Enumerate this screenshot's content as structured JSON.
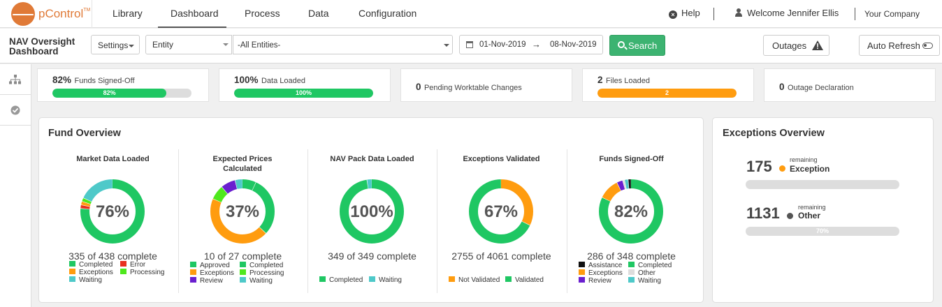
{
  "app": {
    "brand": "pControl",
    "trademark": "TM"
  },
  "nav": {
    "items": [
      "Library",
      "Dashboard",
      "Process",
      "Data",
      "Configuration"
    ],
    "active": "Dashboard"
  },
  "topright": {
    "help": "Help",
    "welcome": "Welcome Jennifer Ellis",
    "company": "Your Company"
  },
  "filters": {
    "page_title_1": "NAV Oversight",
    "page_title_2": "Dashboard",
    "settings": "Settings",
    "entity": "Entity",
    "entities": "-All Entities-",
    "date_from": "01-Nov-2019",
    "date_to": "08-Nov-2019",
    "search": "Search",
    "outages": "Outages",
    "auto_refresh": "Auto Refresh"
  },
  "kpis": [
    {
      "value": "82%",
      "label": "Funds Signed-Off",
      "bar_label": "82%",
      "bar_fraction": 0.82,
      "color": "#1fc763"
    },
    {
      "value": "100%",
      "label": "Data Loaded",
      "bar_label": "100%",
      "bar_fraction": 1.0,
      "color": "#1fc763"
    },
    {
      "value": "0",
      "label": "Pending Worktable Changes"
    },
    {
      "value": "2",
      "label": "Files Loaded",
      "bar_label": "2",
      "bar_fraction": 1.0,
      "color": "#ff9c0f"
    },
    {
      "value": "0",
      "label": "Outage Declaration"
    }
  ],
  "fund_overview": {
    "title": "Fund Overview",
    "charts": [
      {
        "title": "Market Data Loaded",
        "pct": "76%",
        "complete": "335 of 438 complete",
        "segments": [
          {
            "name": "Completed",
            "fraction": 0.765,
            "color": "#1fc763"
          },
          {
            "name": "Error",
            "fraction": 0.018,
            "color": "#e8301f"
          },
          {
            "name": "Exceptions",
            "fraction": 0.018,
            "color": "#ff9c0f"
          },
          {
            "name": "Processing",
            "fraction": 0.018,
            "color": "#4fe81d"
          },
          {
            "name": "Waiting",
            "fraction": 0.181,
            "color": "#4ec9c9"
          }
        ],
        "legend": [
          {
            "label": "Completed",
            "color": "#1fc763"
          },
          {
            "label": "Error",
            "color": "#e8301f"
          },
          {
            "label": "Exceptions",
            "color": "#ff9c0f"
          },
          {
            "label": "Processing",
            "color": "#4fe81d"
          },
          {
            "label": "Waiting",
            "color": "#4ec9c9"
          }
        ]
      },
      {
        "title": "Expected Prices Calculated",
        "pct": "37%",
        "complete": "10 of 27 complete",
        "segments": [
          {
            "name": "Completed",
            "fraction": 0.07,
            "color": "#1fc763"
          },
          {
            "name": "Approved",
            "fraction": 0.3,
            "color": "#1fc763"
          },
          {
            "name": "Exceptions",
            "fraction": 0.444,
            "color": "#ff9c0f"
          },
          {
            "name": "Processing",
            "fraction": 0.074,
            "color": "#4fe81d"
          },
          {
            "name": "Review",
            "fraction": 0.074,
            "color": "#6a1fcf"
          },
          {
            "name": "Waiting",
            "fraction": 0.038,
            "color": "#4ec9c9"
          }
        ],
        "legend": [
          {
            "label": "Approved",
            "color": "#1fc763"
          },
          {
            "label": "Completed",
            "color": "#1fc763"
          },
          {
            "label": "Exceptions",
            "color": "#ff9c0f"
          },
          {
            "label": "Processing",
            "color": "#4fe81d"
          },
          {
            "label": "Review",
            "color": "#6a1fcf"
          },
          {
            "label": "Waiting",
            "color": "#4ec9c9"
          }
        ]
      },
      {
        "title": "NAV Pack Data Loaded",
        "pct": "100%",
        "complete": "349 of 349 complete",
        "segments": [
          {
            "name": "Completed",
            "fraction": 0.975,
            "color": "#1fc763"
          },
          {
            "name": "Waiting",
            "fraction": 0.025,
            "color": "#4ec9c9"
          }
        ],
        "legend": [
          {
            "label": "Completed",
            "color": "#1fc763"
          },
          {
            "label": "Waiting",
            "color": "#4ec9c9"
          }
        ]
      },
      {
        "title": "Exceptions Validated",
        "pct": "67%",
        "complete": "2755 of 4061 complete",
        "segments": [
          {
            "name": "Not Validated",
            "fraction": 0.322,
            "color": "#ff9c0f"
          },
          {
            "name": "Validated",
            "fraction": 0.678,
            "color": "#1fc763"
          }
        ],
        "legend": [
          {
            "label": "Not Validated",
            "color": "#ff9c0f"
          },
          {
            "label": "Validated",
            "color": "#1fc763"
          }
        ]
      },
      {
        "title": "Funds Signed-Off",
        "pct": "82%",
        "complete": "286 of 348 complete",
        "segments": [
          {
            "name": "Completed",
            "fraction": 0.822,
            "color": "#1fc763"
          },
          {
            "name": "Exceptions",
            "fraction": 0.105,
            "color": "#ff9c0f"
          },
          {
            "name": "Review",
            "fraction": 0.03,
            "color": "#6a1fcf"
          },
          {
            "name": "Other",
            "fraction": 0.01,
            "color": "#dddddd"
          },
          {
            "name": "Waiting",
            "fraction": 0.018,
            "color": "#4ec9c9"
          },
          {
            "name": "Assistance",
            "fraction": 0.015,
            "color": "#111111"
          }
        ],
        "legend": [
          {
            "label": "Assistance",
            "color": "#111111"
          },
          {
            "label": "Completed",
            "color": "#1fc763"
          },
          {
            "label": "Exceptions",
            "color": "#ff9c0f"
          },
          {
            "label": "Other",
            "color": "#dddddd"
          },
          {
            "label": "Review",
            "color": "#6a1fcf"
          },
          {
            "label": "Waiting",
            "color": "#4ec9c9"
          }
        ]
      }
    ]
  },
  "exceptions_overview": {
    "title": "Exceptions Overview",
    "items": [
      {
        "count": "175",
        "remaining": "remaining",
        "label": "Exception",
        "dot_color": "#ff9c0f",
        "bar_label": "",
        "bar_fraction": 0
      },
      {
        "count": "1131",
        "remaining": "remaining",
        "label": "Other",
        "dot_color": "#555555",
        "bar_label": "70%",
        "bar_fraction": 0
      }
    ]
  }
}
